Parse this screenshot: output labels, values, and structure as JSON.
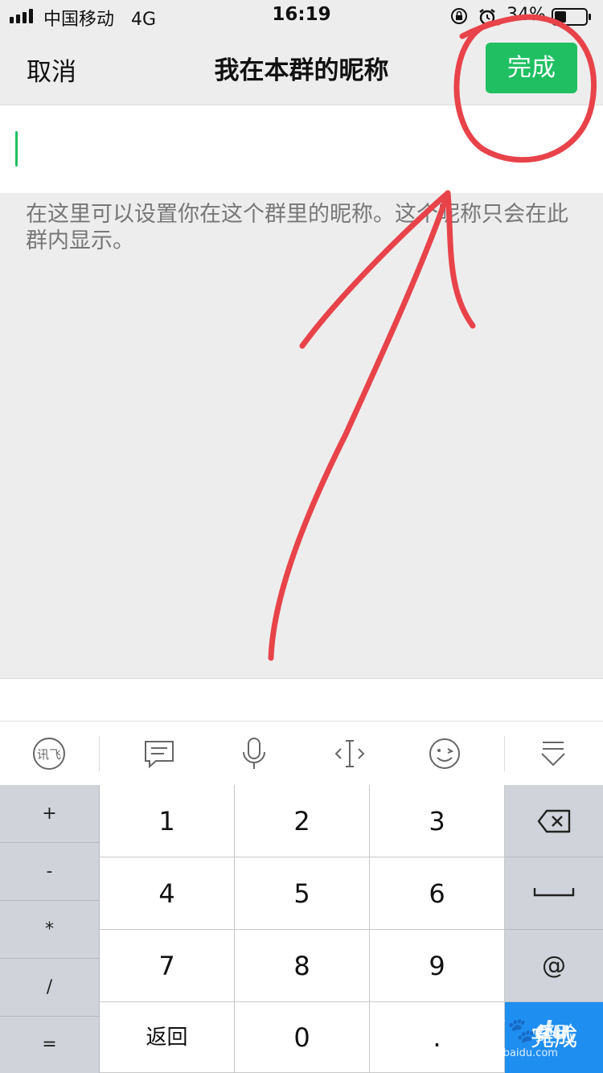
{
  "status_bar": {
    "carrier": "中国移动",
    "network": "4G",
    "time": "16:19",
    "battery": "34%"
  },
  "nav": {
    "cancel": "取消",
    "title": "我在本群的昵称",
    "done": "完成"
  },
  "input": {
    "value": "",
    "placeholder": ""
  },
  "hint": "在这里可以设置你在这个群里的昵称。这个昵称只会在此群内显示。",
  "toolbar": {
    "icons": [
      "ime-logo-icon",
      "chat-bubble-icon",
      "microphone-icon",
      "text-cursor-move-icon",
      "emoji-icon",
      "collapse-keyboard-icon"
    ]
  },
  "keyboard": {
    "symbols": [
      "+",
      "-",
      "*",
      "/",
      "="
    ],
    "rows": [
      [
        "1",
        "2",
        "3"
      ],
      [
        "4",
        "5",
        "6"
      ],
      [
        "7",
        "8",
        "9"
      ],
      [
        "返回",
        "0",
        "."
      ]
    ],
    "at": "@",
    "done": "完成"
  },
  "colors": {
    "accent": "#20c062",
    "annotation": "#e8434a",
    "done_key": "#1f8ef1"
  },
  "watermark": {
    "logo": "Baidu",
    "text": "经验",
    "url": "jingyan.baidu.com"
  }
}
